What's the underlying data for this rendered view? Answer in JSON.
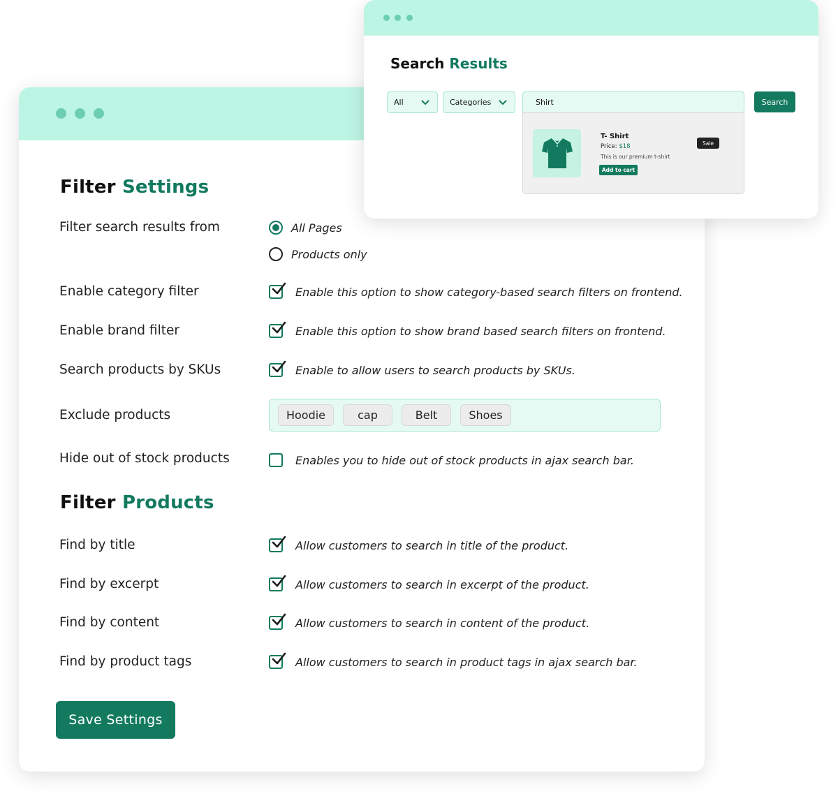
{
  "search_results": {
    "title_prefix": "Search",
    "title_accent": "Results",
    "scope_select": "All",
    "category_select": "Categories",
    "query": "Shirt",
    "search_button": "Search",
    "result": {
      "name": "T- Shirt",
      "price_label": "Price:",
      "price_value": "$18",
      "description": "This is our premium t-shirt",
      "add_to_cart": "Add to cart",
      "badge": "Sale"
    }
  },
  "filter_settings": {
    "title_prefix": "Filter",
    "title_accent": "Settings",
    "rows": {
      "search_from": {
        "label": "Filter search results from",
        "options": [
          "All Pages",
          "Products only"
        ],
        "selected": "All Pages"
      },
      "category_filter": {
        "label": "Enable category filter",
        "checked": true,
        "description": "Enable this option to show category-based search filters on frontend."
      },
      "brand_filter": {
        "label": "Enable brand filter",
        "checked": true,
        "description": "Enable this option to show brand based search filters on frontend."
      },
      "sku_search": {
        "label": "Search products by SKUs",
        "checked": true,
        "description": "Enable to allow users to search products by SKUs."
      },
      "exclude_products": {
        "label": "Exclude products",
        "tags": [
          "Hoodie",
          "cap",
          "Belt",
          "Shoes"
        ]
      },
      "hide_out_of_stock": {
        "label": "Hide out of stock products",
        "checked": false,
        "description": "Enables you to hide out of stock products in ajax search bar."
      }
    }
  },
  "filter_products": {
    "title_prefix": "Filter",
    "title_accent": "Products",
    "rows": {
      "by_title": {
        "label": "Find by title",
        "checked": true,
        "description": "Allow customers to search in title of the product."
      },
      "by_excerpt": {
        "label": "Find by excerpt",
        "checked": true,
        "description": "Allow customers to search in excerpt of the product."
      },
      "by_content": {
        "label": "Find by content",
        "checked": true,
        "description": "Allow customers to search in content of the product."
      },
      "by_tags": {
        "label": "Find by product tags",
        "checked": true,
        "description": "Allow customers to search in product tags in ajax search bar."
      }
    }
  },
  "save_button": "Save Settings",
  "colors": {
    "accent": "#137a5f",
    "titlebar": "#bdf5e5",
    "dots": "#6ccdb2",
    "field_bg": "#e5faf3"
  },
  "icons": {
    "checkbox": "checkmark-icon",
    "dropdown": "chevron-down-icon",
    "product": "tshirt-icon"
  }
}
